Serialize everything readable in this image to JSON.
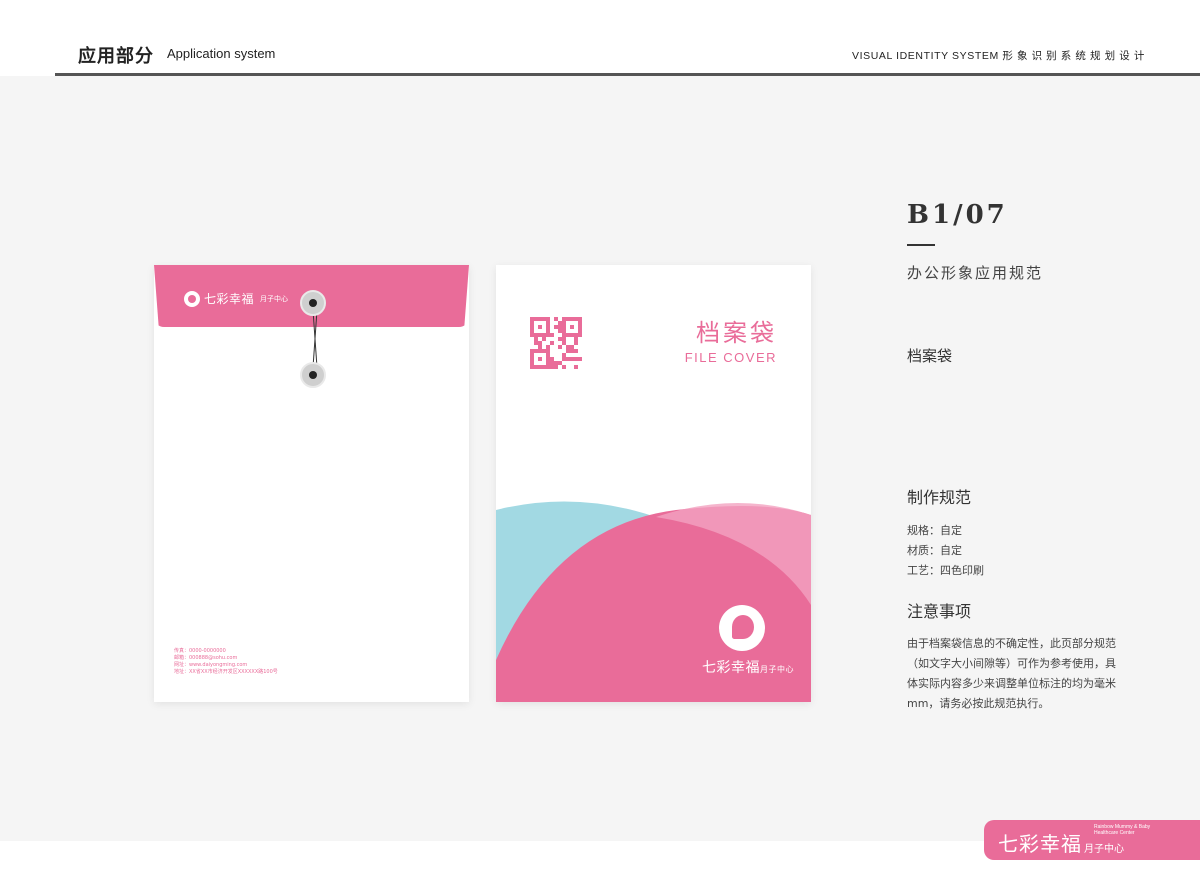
{
  "header": {
    "title": "应用部分",
    "subtitle": "Application system",
    "right_text": "VISUAL IDENTITY SYSTEM  形 象 识 别 系 统 规 划 设 计"
  },
  "envelope": {
    "brand_name": "七彩幸福",
    "brand_suffix": "月子中心",
    "contact_lines": [
      "传真：0000-0000000",
      "邮箱：000888@sohu.com",
      "网址：www.daiyongming.com",
      "地址：XX省XX市经济开发区XXXXXX路100号"
    ]
  },
  "cover": {
    "title": "档案袋",
    "subtitle": "FILE COVER",
    "brand_name": "七彩幸福",
    "brand_suffix": "月子中心",
    "colors": {
      "pink": "#e96c99",
      "blue": "#a2d9e3",
      "light_pink": "#f2a3c0"
    }
  },
  "info": {
    "code": "B1/07",
    "category": "办公形象应用规范",
    "item_name": "档案袋",
    "spec_title": "制作规范",
    "spec_lines": [
      "规格：自定",
      "材质：自定",
      "工艺：四色印刷"
    ],
    "note_title": "注意事项",
    "note_body": "由于档案袋信息的不确定性，此页部分规范（如文字大小间隙等）可作为参考使用，具体实际内容多少来调整单位标注的均为毫米mm，请务必按此规范执行。"
  },
  "badge": {
    "brand_name": "七彩幸福",
    "brand_suffix": "月子中心",
    "english": "Rainbow Mummy & Baby Healthcare Center"
  }
}
